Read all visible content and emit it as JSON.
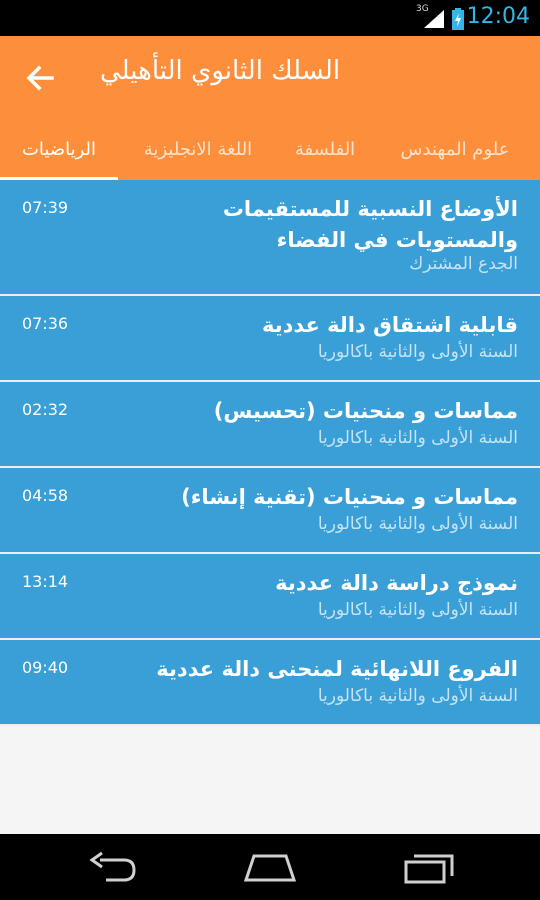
{
  "status_bar": {
    "network": "3G",
    "time": "12:04"
  },
  "app_bar": {
    "title": "السلك الثانوي التأهيلي"
  },
  "tabs": [
    {
      "label": "الرياضيات"
    },
    {
      "label": "اللغة الانجليزية"
    },
    {
      "label": "الفلسفة"
    },
    {
      "label": "علوم المهندس"
    }
  ],
  "videos": [
    {
      "title": "الأوضاع النسبية للمستقيمات والمستويات في الفضاء",
      "duration": "07:39",
      "level": "الجدع المشترك"
    },
    {
      "title": "قابلية اشتقاق دالة عددية",
      "duration": "07:36",
      "level": "السنة الأولى والثانية باكالوريا"
    },
    {
      "title": "مماسات و منحنيات (تحسيس)",
      "duration": "02:32",
      "level": "السنة الأولى والثانية باكالوريا"
    },
    {
      "title": "مماسات و منحنيات (تقنية إنشاء)",
      "duration": "04:58",
      "level": "السنة الأولى والثانية باكالوريا"
    },
    {
      "title": "نموذج دراسة دالة عددية",
      "duration": "13:14",
      "level": "السنة الأولى والثانية باكالوريا"
    },
    {
      "title": "الفروع اللانهائية لمنحنى دالة عددية",
      "duration": "09:40",
      "level": "السنة الأولى والثانية باكالوريا"
    }
  ],
  "colors": {
    "app_bar": "#fd8f3c",
    "list_item": "#3a9fd6",
    "status_accent": "#33b5e5"
  }
}
